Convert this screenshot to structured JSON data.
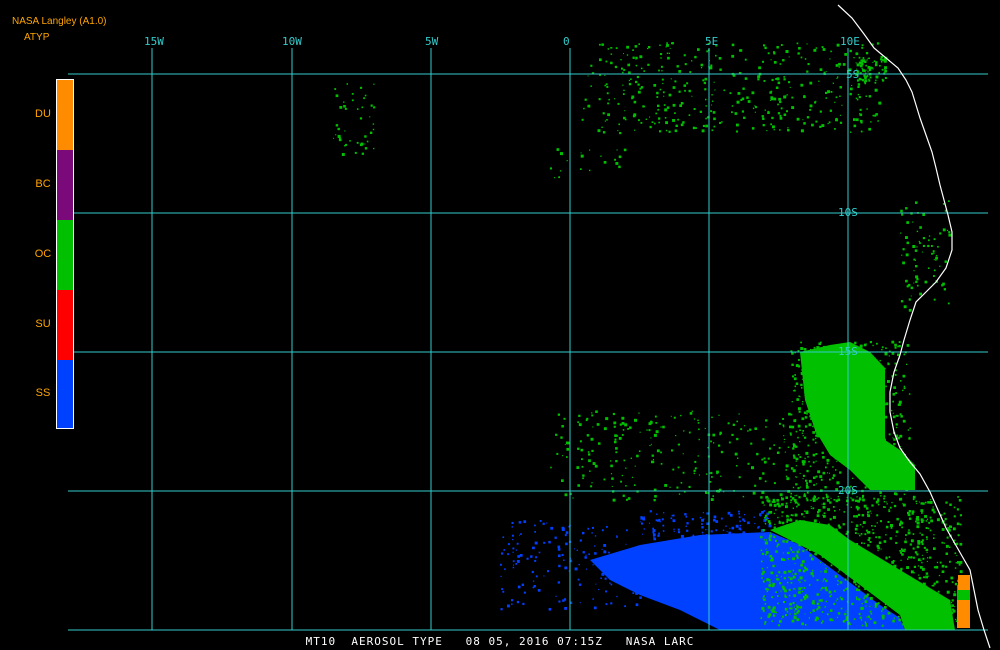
{
  "header": {
    "source": "NASA Langley (A1.0)",
    "product": "ATYP"
  },
  "legend": [
    {
      "code": "DU",
      "color": "#ff8c00"
    },
    {
      "code": "BC",
      "color": "#7a0a7a"
    },
    {
      "code": "OC",
      "color": "#00c000"
    },
    {
      "code": "SU",
      "color": "#ff0000"
    },
    {
      "code": "SS",
      "color": "#0040ff"
    }
  ],
  "longitude_labels": [
    "15W",
    "10W",
    "5W",
    "0",
    "5E",
    "10E"
  ],
  "latitude_labels": [
    "5S",
    "10S",
    "15S",
    "20S"
  ],
  "footer": {
    "text": "MT10  AEROSOL TYPE   08 05, 2016 07:15Z   NASA LARC"
  },
  "colors": {
    "grid": "#33cccc",
    "coastline": "#ffffff",
    "background": "#000000"
  }
}
